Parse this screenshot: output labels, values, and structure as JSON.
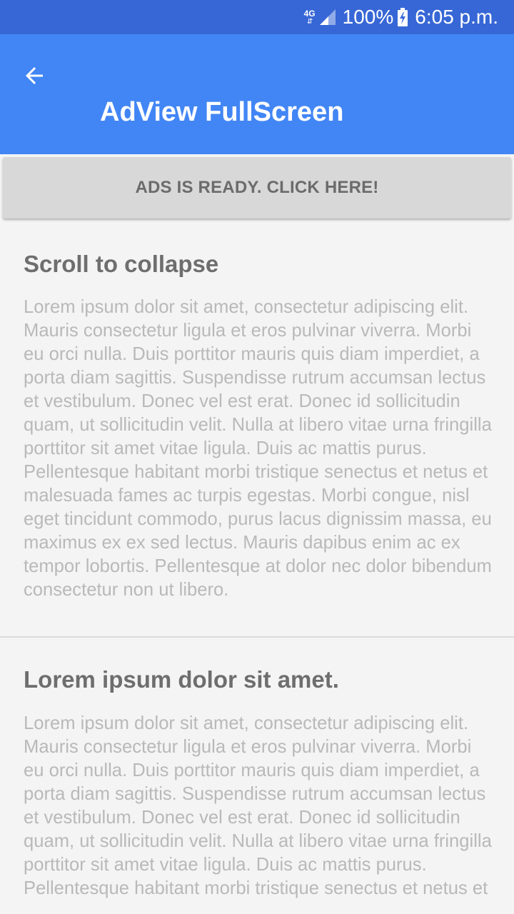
{
  "status_bar": {
    "network": "4G",
    "battery": "100%",
    "time": "6:05 p.m.",
    "background": "#3767d6"
  },
  "app_bar": {
    "title": "AdView FullScreen",
    "back_icon": "arrow-back-icon",
    "background": "#4286f5"
  },
  "ads_button": {
    "label": "ADS IS READY. CLICK HERE!"
  },
  "sections": [
    {
      "title": "Scroll to collapse",
      "body": "Lorem ipsum dolor sit amet, consectetur adipiscing elit. Mauris consectetur ligula et eros pulvinar viverra. Morbi eu orci nulla. Duis porttitor mauris quis diam imperdiet, a porta diam sagittis. Suspendisse rutrum accumsan lectus et vestibulum. Donec vel est erat. Donec id sollicitudin quam, ut sollicitudin velit. Nulla at libero vitae urna fringilla porttitor sit amet vitae ligula. Duis ac mattis purus. Pellentesque habitant morbi tristique senectus et netus et malesuada fames ac turpis egestas. Morbi congue, nisl eget tincidunt commodo, purus lacus dignissim massa, eu maximus ex ex sed lectus. Mauris dapibus enim ac ex tempor lobortis. Pellentesque at dolor nec dolor bibendum consectetur non ut libero."
    },
    {
      "title": "Lorem ipsum dolor sit amet.",
      "body": "Lorem ipsum dolor sit amet, consectetur adipiscing elit. Mauris consectetur ligula et eros pulvinar viverra. Morbi eu orci nulla. Duis porttitor mauris quis diam imperdiet, a porta diam sagittis. Suspendisse rutrum accumsan lectus et vestibulum. Donec vel est erat. Donec id sollicitudin quam, ut sollicitudin velit. Nulla at libero vitae urna fringilla porttitor sit amet vitae ligula. Duis ac mattis purus. Pellentesque habitant morbi tristique senectus et netus et"
    }
  ]
}
